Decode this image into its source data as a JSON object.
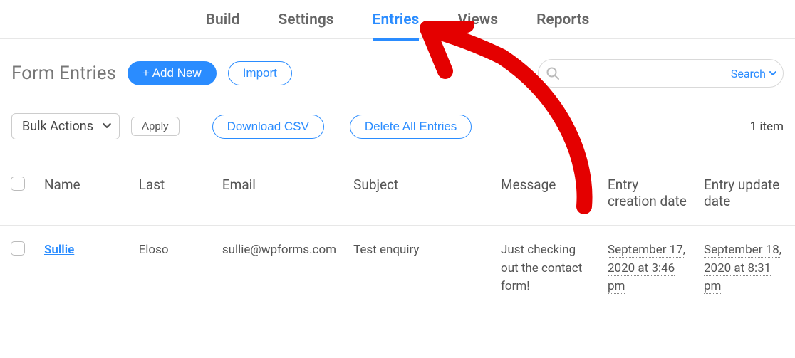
{
  "nav": {
    "items": [
      {
        "label": "Build"
      },
      {
        "label": "Settings"
      },
      {
        "label": "Entries",
        "active": true
      },
      {
        "label": "Views"
      },
      {
        "label": "Reports"
      }
    ]
  },
  "page": {
    "title": "Form Entries",
    "add_label": "+  Add New",
    "import_label": "Import"
  },
  "search": {
    "placeholder": "",
    "button_label": "Search"
  },
  "toolbar": {
    "bulk_label": "Bulk Actions",
    "apply_label": "Apply",
    "download_csv_label": "Download CSV",
    "delete_all_label": "Delete All Entries",
    "item_count": "1 item"
  },
  "table": {
    "headers": {
      "name": "Name",
      "last": "Last",
      "email": "Email",
      "subject": "Subject",
      "message": "Message",
      "created": "Entry creation date",
      "updated": "Entry update date"
    },
    "rows": [
      {
        "name": "Sullie",
        "last": "Eloso",
        "email": "sullie@wpforms.com",
        "subject": "Test enquiry",
        "message": "Just checking out the contact form!",
        "created": "September 17, 2020 at 3:46 pm",
        "updated": "September 18, 2020 at 8:31 pm"
      }
    ]
  }
}
